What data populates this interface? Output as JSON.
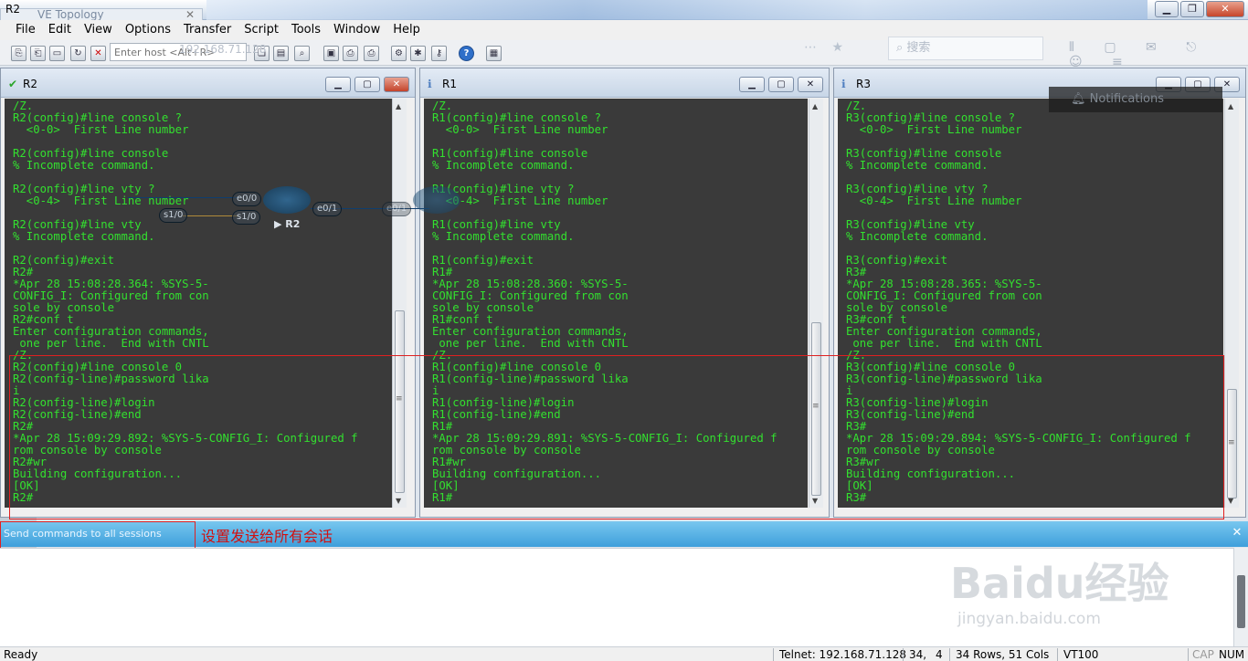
{
  "window": {
    "title": "R2",
    "ghost_tab": "VE Topology",
    "ghost_ip": "192.168.71.128",
    "ghost_search": "搜索",
    "minimize": "▁",
    "maximize": "❐",
    "close": "✕"
  },
  "menu": [
    "File",
    "Edit",
    "View",
    "Options",
    "Transfer",
    "Script",
    "Tools",
    "Window",
    "Help"
  ],
  "toolbar": {
    "host_placeholder": "Enter host <Alt+R>"
  },
  "sessions": [
    {
      "name": "R2",
      "status_icon": "connected-check-icon",
      "lines": "/Z.\nR2(config)#line console ?\n  <0-0>  First Line number\n\nR2(config)#line console\n% Incomplete command.\n\nR2(config)#line vty ?\n  <0-4>  First Line number\n\nR2(config)#line vty\n% Incomplete command.\n\nR2(config)#exit\nR2#\n*Apr 28 15:08:28.364: %SYS-5-\nCONFIG_I: Configured from con\nsole by console\nR2#conf t\nEnter configuration commands,\n one per line.  End with CNTL\n/Z.\nR2(config)#line console 0\nR2(config-line)#password lika\ni\nR2(config-line)#login\nR2(config-line)#end\nR2#\n*Apr 28 15:09:29.892: %SYS-5-CONFIG_I: Configured f\nrom console by console\nR2#wr\nBuilding configuration...\n[OK]\nR2#"
    },
    {
      "name": "R1",
      "status_icon": "info-icon",
      "lines": "/Z.\nR1(config)#line console ?\n  <0-0>  First Line number\n\nR1(config)#line console\n% Incomplete command.\n\nR1(config)#line vty ?\n  <0-4>  First Line number\n\nR1(config)#line vty\n% Incomplete command.\n\nR1(config)#exit\nR1#\n*Apr 28 15:08:28.360: %SYS-5-\nCONFIG_I: Configured from con\nsole by console\nR1#conf t\nEnter configuration commands,\n one per line.  End with CNTL\n/Z.\nR1(config)#line console 0\nR1(config-line)#password lika\ni\nR1(config-line)#login\nR1(config-line)#end\nR1#\n*Apr 28 15:09:29.891: %SYS-5-CONFIG_I: Configured f\nrom console by console\nR1#wr\nBuilding configuration...\n[OK]\nR1#"
    },
    {
      "name": "R3",
      "status_icon": "info-icon",
      "lines": "/Z.\nR3(config)#line console ?\n  <0-0>  First Line number\n\nR3(config)#line console\n% Incomplete command.\n\nR3(config)#line vty ?\n  <0-4>  First Line number\n\nR3(config)#line vty\n% Incomplete command.\n\nR3(config)#exit\nR3#\n*Apr 28 15:08:28.365: %SYS-5-\nCONFIG_I: Configured from con\nsole by console\nR3#conf t\nEnter configuration commands,\n one per line.  End with CNTL\n/Z.\nR3(config)#line console 0\nR3(config-line)#password lika\ni\nR3(config-line)#login\nR3(config-line)#end\nR3#\n*Apr 28 15:09:29.894: %SYS-5-CONFIG_I: Configured f\nrom console by console\nR3#wr\nBuilding configuration...\n[OK]\nR3#"
    }
  ],
  "topology_ghost": {
    "ports": [
      "e0/0",
      "s1/0",
      "s1/0",
      "e0/1",
      "e0/1"
    ],
    "router_label": "▶ R2"
  },
  "notifications": "Notifications",
  "send_bar": {
    "label": "Send commands to all sessions",
    "annotation": "设置发送给所有会话",
    "close": "✕"
  },
  "watermark": {
    "brand": "Baidu经验",
    "url": "jingyan.baidu.com"
  },
  "status": {
    "ready": "Ready",
    "connection": "Telnet: 192.168.71.128",
    "cursor_row": "34,",
    "cursor_col": "4",
    "size": "34 Rows, 51 Cols",
    "emulation": "VT100",
    "caps": "CAP",
    "num": "NUM"
  },
  "colors": {
    "terminal_bg": "#3a3a3a",
    "terminal_fg": "#33e02f",
    "highlight": "#e02020",
    "send_bar": "#3e9fdb"
  }
}
